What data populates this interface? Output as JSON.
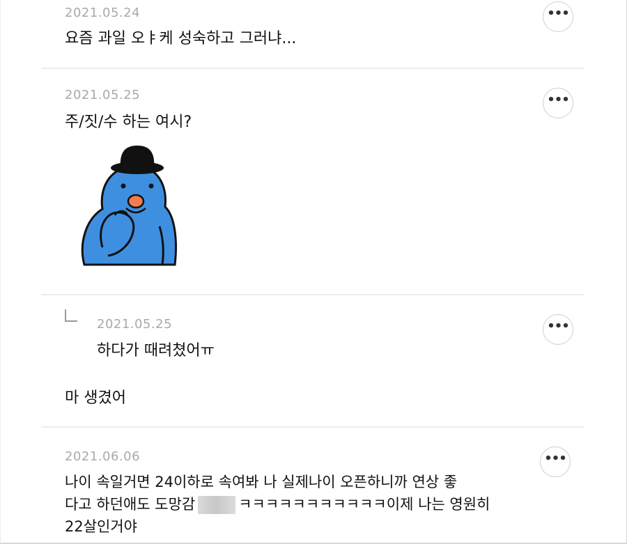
{
  "comments": [
    {
      "date": "2021.05.24",
      "text": "요즘 과일 오ㅑ케 성숙하고 그러냐...",
      "more_label": "•••"
    },
    {
      "date": "2021.05.25",
      "text": "주/짓/수 하는 여시?",
      "sticker": "blue-character-hat-sticker",
      "more_label": "•••"
    },
    {
      "is_reply": true,
      "date": "2021.05.25",
      "text": "하다가 때려쳤어ㅠ",
      "more_label": "•••"
    },
    {
      "text": "마 생겼어"
    },
    {
      "date": "2021.06.06",
      "line1": "나이 속일거면 24이하로 속여봐 나 실제나이 오픈하니까 연상 좋",
      "line2a": "다고 하던애도 도망감",
      "line2b": "ㅋㅋㅋㅋㅋㅋㅋㅋㅋㅋㅋ이제 나는 영원히",
      "line3": "22살인거야",
      "more_label": "•••"
    }
  ],
  "colors": {
    "date": "#a9a9a9",
    "text": "#111111",
    "divider": "#ececec",
    "sticker_body": "#3f8fe0",
    "sticker_nose": "#f07c4f"
  }
}
